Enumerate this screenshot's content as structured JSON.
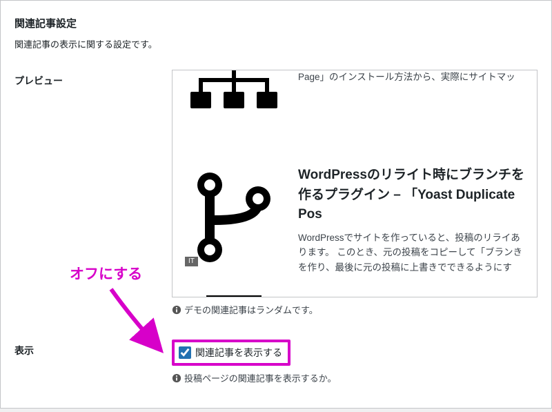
{
  "section": {
    "title": "関連記事設定",
    "desc": "関連記事の表示に関する設定です。"
  },
  "preview": {
    "label": "プレビュー",
    "note": "デモの関連記事はランダムです。",
    "items": [
      {
        "excerpt": "WrordPressで新規サイトを作りましたが、ユーザ向ラグインで作ることにしました。 このページでは、Page」のインストール方法から、実際にサイトマッ",
        "tag": ""
      },
      {
        "title": "WordPressのリライト時にブランチを作るプラグイン – 「Yoast Duplicate Pos",
        "excerpt": "WordPressでサイトを作っていると、投稿のリライあります。 このとき、元の投稿をコピーして「ブランきを作り、最後に元の投稿に上書きでできるようにす",
        "tag": "IT"
      }
    ]
  },
  "display": {
    "label": "表示",
    "checkbox_label": "関連記事を表示する",
    "note": "投稿ページの関連記事を表示するか。"
  },
  "annotation": {
    "text": "オフにする"
  }
}
